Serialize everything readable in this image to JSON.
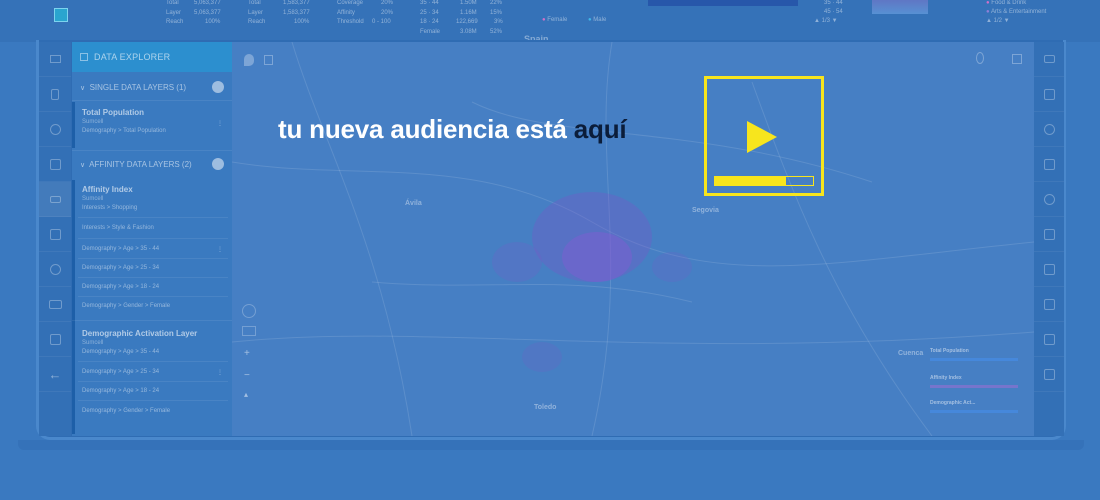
{
  "overlay": {
    "headline_main": "tu nueva audiencia está",
    "headline_accent": "aquí",
    "progress": 0.72,
    "colors": {
      "accent": "#f7e51d",
      "headline": "#ffffff",
      "headline_accent": "#0b1d3a",
      "background": "#3a79c0"
    }
  },
  "top_stats": {
    "col1": [
      "Total",
      "Layer",
      "Reach"
    ],
    "col1_vals": [
      "5,063,377",
      "5,063,377",
      "100%"
    ],
    "col2": [
      "Total",
      "Layer",
      "Reach"
    ],
    "col2_vals": [
      "1,583,377",
      "1,583,377",
      "100%"
    ],
    "col3": [
      "Coverage",
      "Affinity",
      "Threshold"
    ],
    "col3_vals": [
      "20%",
      "20%",
      "0 - 100"
    ],
    "ages": [
      "35 · 44",
      "25 · 34",
      "18 · 24"
    ],
    "age_vals": [
      "1.50M",
      "1.16M",
      "122,669"
    ],
    "age_pct": [
      "22%",
      "15%",
      "3%"
    ],
    "gender_row": {
      "label": "Female",
      "value": "3.08M",
      "pct": "52%"
    },
    "legend_female": "Female",
    "legend_male": "Male",
    "right_ages": [
      "35 · 44",
      "45 · 54"
    ],
    "right_page": "1/3",
    "interests": [
      "Food & Drink",
      "Arts & Entertainment"
    ],
    "interests_page": "1/2",
    "country": "Spain"
  },
  "panel": {
    "title": "DATA EXPLORER",
    "single_section": "SINGLE DATA LAYERS (1)",
    "single_items": [
      {
        "title": "Total Population",
        "sub": "Sumcell",
        "desc": "Demography > Total Population"
      }
    ],
    "affinity_section": "AFFINITY DATA LAYERS (2)",
    "affinity_items": [
      {
        "title": "Affinity Index",
        "sub": "Sumcell",
        "rows": [
          "Interests > Shopping",
          "Interests > Style & Fashion",
          "Demography > Age > 35 - 44",
          "Demography > Age > 25 - 34",
          "Demography > Age > 18 - 24",
          "Demography > Gender > Female"
        ]
      },
      {
        "title": "Demographic Activation Layer",
        "sub": "Sumcell",
        "rows": [
          "Demography > Age > 35 - 44",
          "Demography > Age > 25 - 34",
          "Demography > Age > 18 - 24",
          "Demography > Gender > Female"
        ]
      }
    ]
  },
  "map": {
    "cities": [
      "Ávila",
      "Segovia",
      "Toledo",
      "Cuenca"
    ],
    "legend": {
      "l1": "Total Population",
      "l2": "Affinity Index",
      "l3": "Demographic Act..."
    },
    "zoom_in": "+",
    "zoom_out": "−"
  }
}
